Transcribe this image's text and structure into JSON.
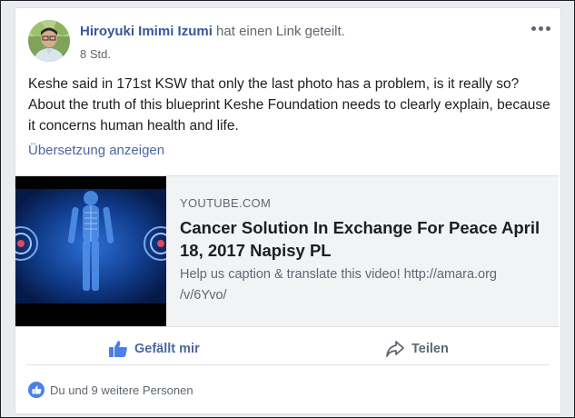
{
  "post": {
    "author": "Hiroyuki Imimi Izumi",
    "action": "hat einen Link geteilt.",
    "time": "8 Std.",
    "text": "Keshe said in 171st KSW that only the last photo has a problem, is it really so? About the truth of this blueprint Keshe Foundation needs to clearly explain, because it concerns human health and life.",
    "translate": "Übersetzung anzeigen"
  },
  "link": {
    "domain": "YOUTUBE.COM",
    "title": "Cancer Solution In Exchange For Peace April 18, 2017 Napisy PL",
    "description": "Help us caption & translate this video! http://amara.org /v/6Yvo/"
  },
  "actions": {
    "like": "Gefällt mir",
    "share": "Teilen"
  },
  "reactions": {
    "summary": "Du und 9 weitere Personen"
  },
  "icons": {
    "more": "more-options-icon",
    "like": "thumbs-up-icon",
    "share": "share-arrow-icon",
    "reaction": "like-reaction-icon"
  },
  "colors": {
    "link_blue": "#385898",
    "like_blue": "#4b67a1",
    "text": "#1c1e21",
    "muted": "#606770"
  }
}
